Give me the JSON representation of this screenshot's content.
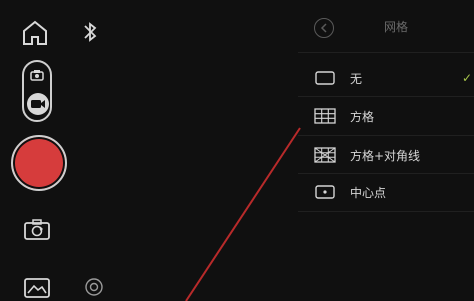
{
  "colors": {
    "accent_red": "#d63c3c",
    "check_green": "#a7c64a"
  },
  "left_toolbar": {
    "home_icon": "home-icon",
    "bluetooth_icon": "bluetooth-icon",
    "mode_toggle": {
      "top_icon": "camera-icon",
      "bottom_icon": "video-icon",
      "selected": "video"
    },
    "shutter_icon": "record-button",
    "flip_icon": "camera-flip-icon",
    "gallery_icon": "gallery-icon",
    "focus_icon": "focus-target-icon"
  },
  "menu": {
    "title": "网格",
    "back_icon": "back-arrow-icon",
    "items": [
      {
        "label": "无",
        "icon": "empty-square-icon",
        "selected": true
      },
      {
        "label": "方格",
        "icon": "grid-icon",
        "selected": false
      },
      {
        "label": "方格+对角线",
        "icon": "grid-diagonal-icon",
        "selected": false
      },
      {
        "label": "中心点",
        "icon": "center-point-icon",
        "selected": false
      }
    ],
    "check_mark": "✓"
  }
}
